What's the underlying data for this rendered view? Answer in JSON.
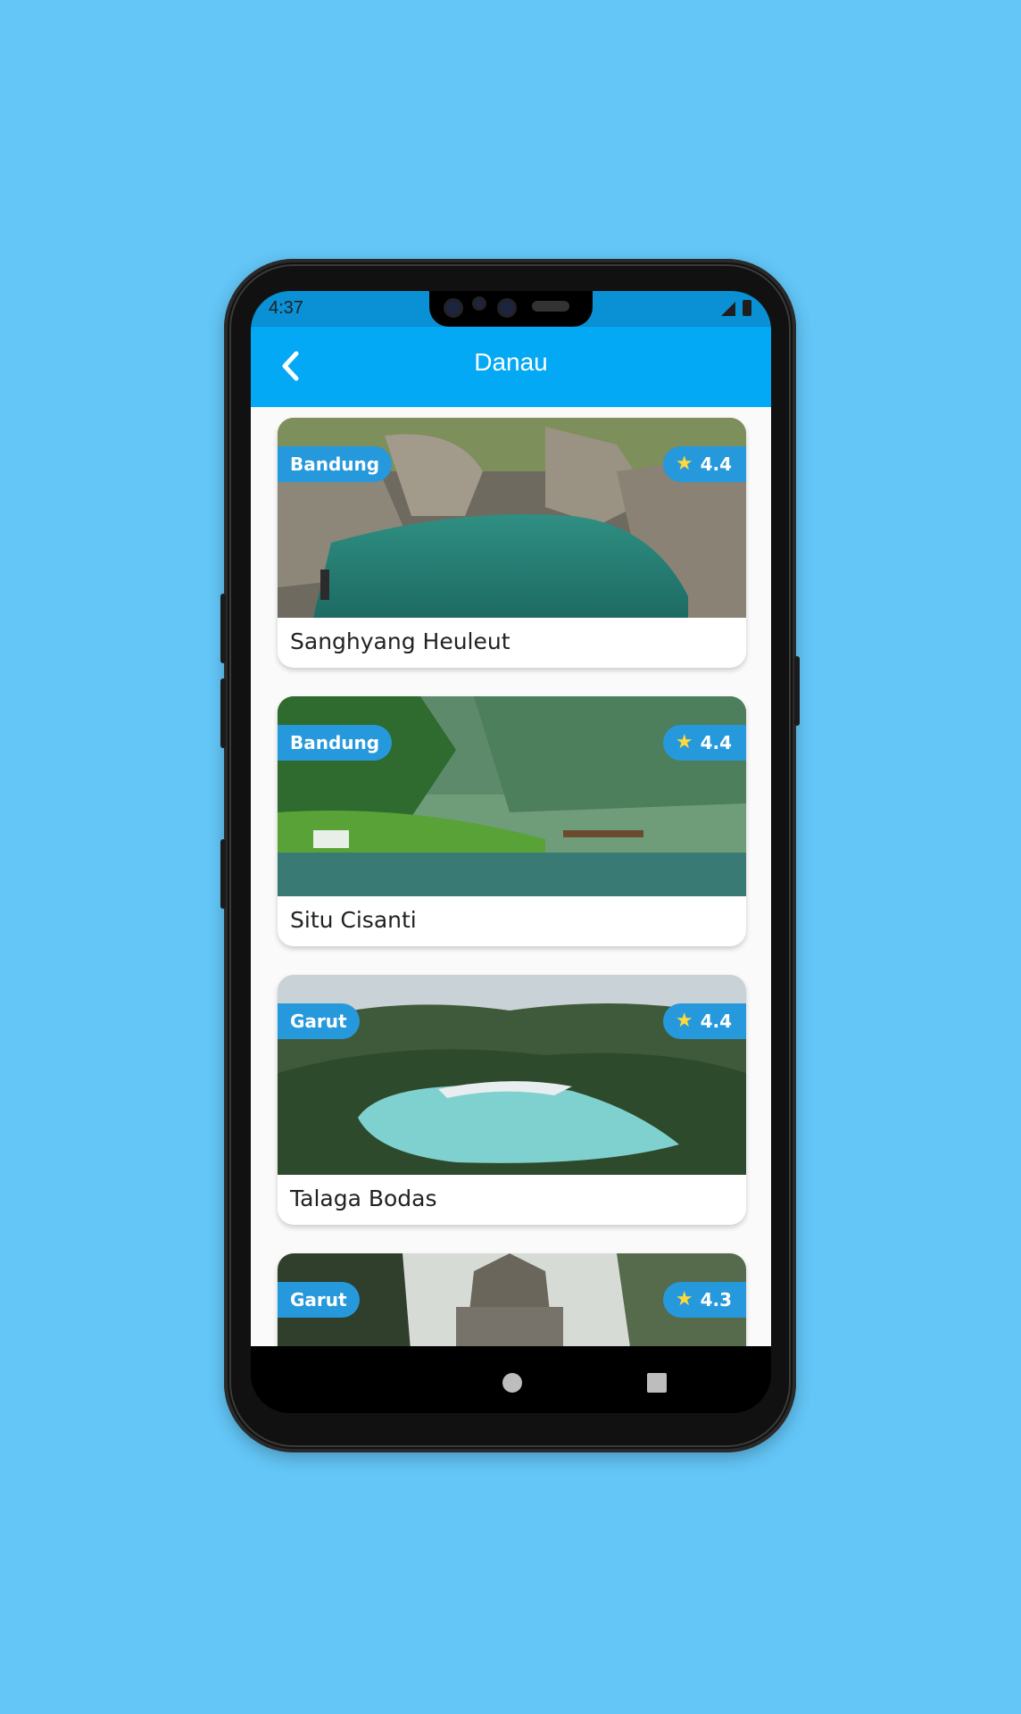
{
  "status": {
    "time": "4:37"
  },
  "app_bar": {
    "title": "Danau"
  },
  "places": [
    {
      "name": "Sanghyang Heuleut",
      "city": "Bandung",
      "rating": "4.4"
    },
    {
      "name": "Situ Cisanti",
      "city": "Bandung",
      "rating": "4.4"
    },
    {
      "name": "Talaga Bodas",
      "city": "Garut",
      "rating": "4.4"
    },
    {
      "name": "",
      "city": "Garut",
      "rating": "4.3"
    }
  ],
  "colors": {
    "page_background": "#63C6F7",
    "app_bar": "#03A9F4",
    "status_bar": "#0A90D5",
    "badge": "#2699DC",
    "star": "#FFD83A"
  },
  "icons": {
    "back": "chevron-left-icon",
    "rating": "star-icon",
    "home": "circle-home-icon",
    "recents": "square-recents-icon"
  }
}
